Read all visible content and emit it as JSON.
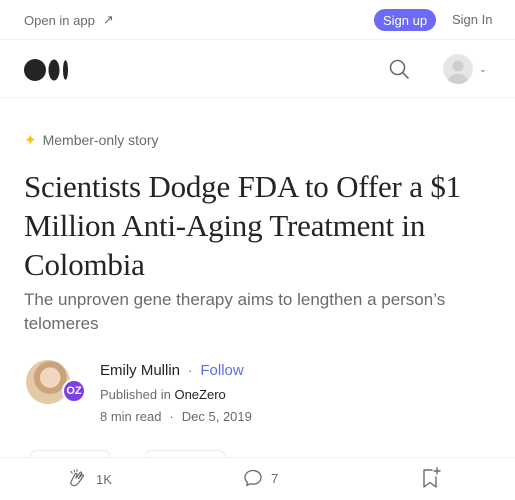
{
  "topbar": {
    "open_in_app": "Open in app",
    "sign_up": "Sign up",
    "sign_in": "Sign In"
  },
  "icons": {
    "logo": "medium-logo-icon",
    "search": "search-icon",
    "avatar": "user-avatar-icon",
    "chevron": "chevron-down-icon",
    "member_star": "star-icon",
    "clap": "clap-icon",
    "comment": "comment-icon",
    "bookmark": "bookmark-add-icon"
  },
  "article": {
    "member_label": "Member-only story",
    "title": "Scientists Dodge FDA to Offer a $1 Million Anti-Aging Treatment in Colombia",
    "subtitle": "The unproven gene therapy aims to lengthen a person’s telomeres"
  },
  "author": {
    "name": "Emily Mullin",
    "follow": "Follow",
    "published_in": "Published in",
    "publication": "OneZero",
    "publication_badge": "OZ",
    "read_time": "8 min read",
    "date": "Dec 5, 2019"
  },
  "actions": {
    "claps": "1K",
    "comments": "7"
  },
  "colors": {
    "accent": "#6b6bf5",
    "follow": "#5b6ee8",
    "star": "#ffc017",
    "publication_badge": "#7a3fe6"
  }
}
